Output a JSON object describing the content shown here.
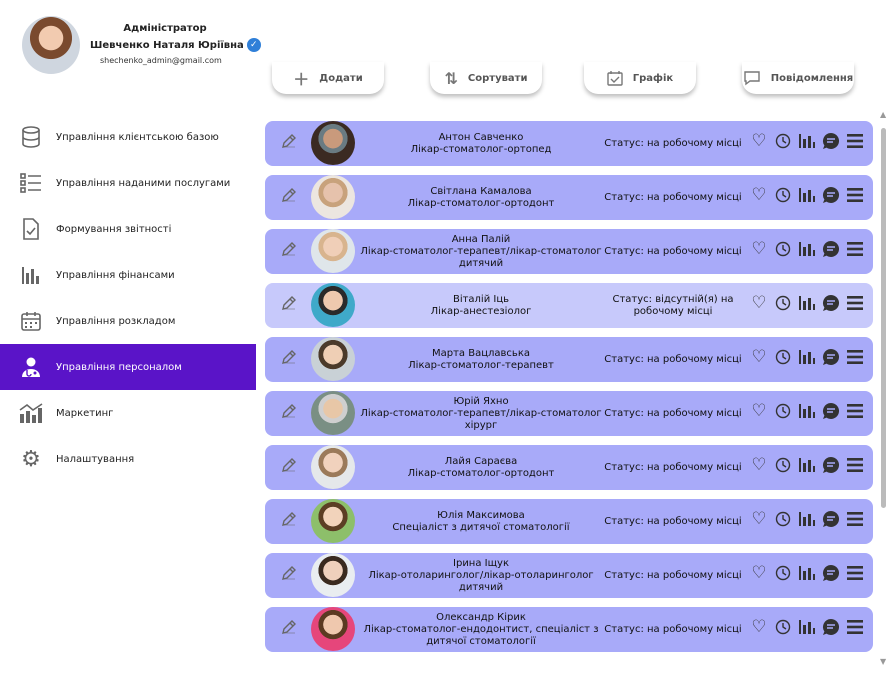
{
  "profile": {
    "role": "Адміністратор",
    "name": "Шевченко Наталя Юріївна",
    "email": "shechenko_admin@gmail.com"
  },
  "nav": [
    {
      "label": "Управління клієнтською базою",
      "icon": "database-icon",
      "active": false
    },
    {
      "label": "Управління наданими послугами",
      "icon": "list-icon",
      "active": false
    },
    {
      "label": "Формування звітності",
      "icon": "document-check-icon",
      "active": false
    },
    {
      "label": "Управління фінансами",
      "icon": "bar-chart-icon",
      "active": false
    },
    {
      "label": "Управління розкладом",
      "icon": "calendar-icon",
      "active": false
    },
    {
      "label": "Управління персоналом",
      "icon": "doctor-icon",
      "active": true
    },
    {
      "label": "Маркетинг",
      "icon": "chart-growth-icon",
      "active": false
    },
    {
      "label": "Налаштування",
      "icon": "gear-icon",
      "active": false
    }
  ],
  "toolbar": {
    "add": "Додати",
    "sort": "Сортувати",
    "schedule": "Графік",
    "messages": "Повідомлення"
  },
  "staff": [
    {
      "name": "Антон Савченко",
      "position": "Лікар-стоматолог-ортопед",
      "status": "Статус: на робочому місці",
      "highlight": false
    },
    {
      "name": "Світлана Камалова",
      "position": "Лікар-стоматолог-ортодонт",
      "status": "Статус: на робочому місці",
      "highlight": false
    },
    {
      "name": "Анна Палій",
      "position": "Лікар-стоматолог-терапевт/лікар-стоматолог дитячий",
      "status": "Статус: на робочому місці",
      "highlight": false
    },
    {
      "name": "Віталій Іць",
      "position": "Лікар-анестезіолог",
      "status": "Статус: відсутній(я) на робочому місці",
      "highlight": true
    },
    {
      "name": "Марта Вацлавська",
      "position": "Лікар-стоматолог-терапевт",
      "status": "Статус: на робочому місці",
      "highlight": false
    },
    {
      "name": "Юрій Яхно",
      "position": "Лікар-стоматолог-терапевт/лікар-стоматолог хірург",
      "status": "Статус: на робочому місці",
      "highlight": false
    },
    {
      "name": "Лайя Сараєва",
      "position": "Лікар-стоматолог-ортодонт",
      "status": "Статус: на робочому місці",
      "highlight": false
    },
    {
      "name": "Юлія Максимова",
      "position": "Спеціаліст з дитячої стоматології",
      "status": "Статус: на робочому місці",
      "highlight": false
    },
    {
      "name": "Ірина Іщук",
      "position": "Лікар-отоларинголог/лікар-отоларинголог дитячий",
      "status": "Статус: на робочому місці",
      "highlight": false
    },
    {
      "name": "Олександр Кірик",
      "position": "Лікар-стоматолог-ендодонтист, спеціаліст з дитячої стоматології",
      "status": "Статус: на робочому місці",
      "highlight": false
    }
  ],
  "colors": {
    "accent": "#5a14c8",
    "row": "#a8aaf9",
    "row_highlight": "#c7c9fb"
  }
}
